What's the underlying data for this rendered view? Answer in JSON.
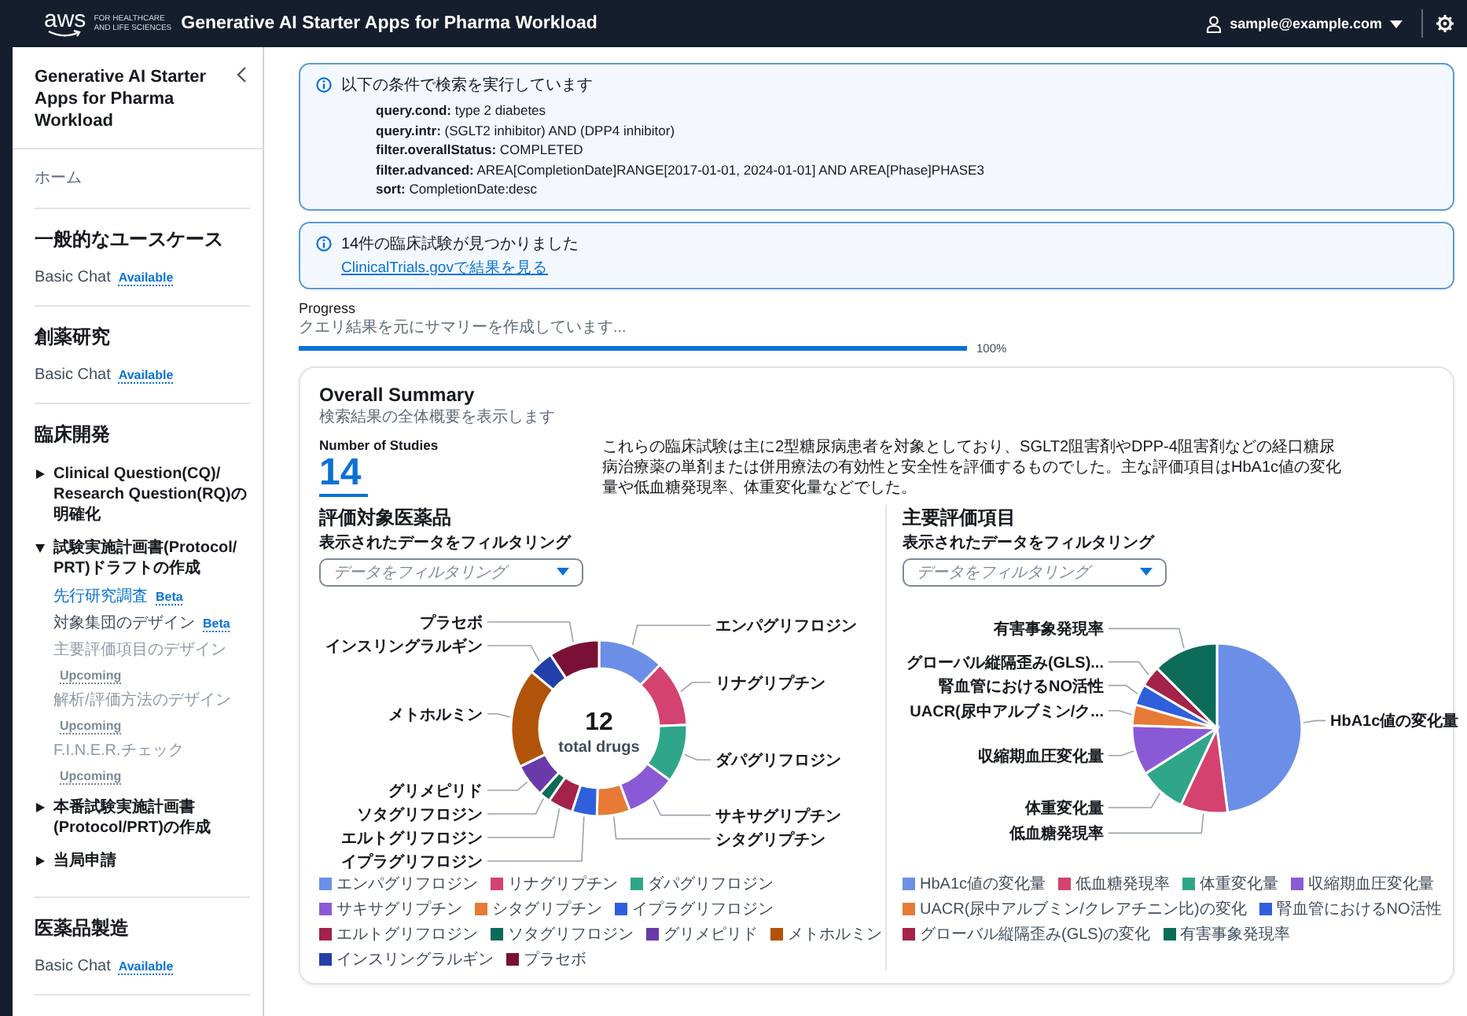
{
  "header": {
    "logo": {
      "wordmark": "aws",
      "tagline": [
        "FOR HEALTHCARE",
        "AND LIFE SCIENCES"
      ]
    },
    "title": "Generative AI Starter Apps for Pharma Workload",
    "user": "sample@example.com"
  },
  "sidebar": {
    "title": "Generative AI Starter Apps for Pharma Workload",
    "home": "ホーム",
    "sections": [
      {
        "title": "一般的なユースケース",
        "items": [
          {
            "kind": "link",
            "label": "Basic Chat",
            "badge": "Available",
            "selected": false,
            "disabled": false
          }
        ]
      },
      {
        "title": "創薬研究",
        "items": [
          {
            "kind": "link",
            "label": "Basic Chat",
            "badge": "Available",
            "selected": false,
            "disabled": false
          }
        ]
      },
      {
        "title": "臨床開発",
        "items": [
          {
            "kind": "group",
            "label": "Clinical Question(CQ)/ Research Question(RQ)の明確化",
            "expanded": false
          },
          {
            "kind": "group",
            "label": "試験実施計画書(Protocol/ PRT)ドラフトの作成",
            "expanded": true,
            "children": [
              {
                "label": "先行研究調査",
                "badge": "Beta",
                "selected": true,
                "disabled": false
              },
              {
                "label": "対象集団のデザイン",
                "badge": "Beta",
                "selected": false,
                "disabled": false
              },
              {
                "label": "主要評価項目のデザイン",
                "badge": "Upcoming",
                "selected": false,
                "disabled": true
              },
              {
                "label": "解析/評価方法のデザイン",
                "badge": "Upcoming",
                "selected": false,
                "disabled": true
              },
              {
                "label": "F.I.N.E.R.チェック",
                "badge": "Upcoming",
                "selected": false,
                "disabled": true
              }
            ]
          },
          {
            "kind": "group",
            "label": "本番試験実施計画書(Protocol/PRT)の作成",
            "expanded": false
          },
          {
            "kind": "group",
            "label": "当局申請",
            "expanded": false
          }
        ]
      },
      {
        "title": "医薬品製造",
        "items": [
          {
            "kind": "link",
            "label": "Basic Chat",
            "badge": "Available",
            "selected": false,
            "disabled": false
          }
        ]
      }
    ]
  },
  "search_info": {
    "title": "以下の条件で検索を実行しています",
    "params": [
      "**query.cond:** type 2 diabetes",
      "**query.intr:** (SGLT2 inhibitor) AND (DPP4 inhibitor)",
      "**filter.overallStatus:** COMPLETED",
      "**filter.advanced:** AREA[CompletionDate]RANGE[2017-01-01, 2024-01-01] AND AREA[Phase]PHASE3",
      "**sort:** CompletionDate:desc"
    ]
  },
  "result_info": {
    "message": "14件の臨床試験が見つかりました",
    "link": "ClinicalTrials.govで結果を見る"
  },
  "progress": {
    "label": "Progress",
    "description": "クエリ結果を元にサマリーを作成しています...",
    "level": 1,
    "reading": "100%"
  },
  "summary": {
    "title": "Overall Summary",
    "subtitle": "検索結果の全体概要を表示します",
    "stat_label": "Number of Studies",
    "stat_value": "14",
    "description": "これらの臨床試験は主に2型糖尿病患者を対象としており、SGLT2阻害剤やDPP-4阻害剤などの経口糖尿病治療薬の単剤または併用療法の有効性と安全性を評価するものでした。主な評価項目はHbA1c値の変化量や低血糖発現率、体重変化量などでした。",
    "panels": [
      {
        "title": "評価対象医薬品",
        "filter_label": "表示されたデータをフィルタリング",
        "filter": {
          "placeholder": "データをフィルタリング"
        },
        "center": {
          "value": "12",
          "label": "total drugs"
        },
        "chart_data": {
          "type": "donut",
          "categories": [
            "エンパグリフロジン",
            "リナグリプチン",
            "ダパグリフロジン",
            "サキサグリプチン",
            "シタグリプチン",
            "イプラグリフロジン",
            "エルトグリフロジン",
            "ソタグリフロジン",
            "グリメピリド",
            "メトホルミン",
            "インスリングラルギン",
            "プラセボ"
          ],
          "series": [
            {
              "values": [
                12.2,
                12.2,
                10.7,
                9.2,
                6.1,
                4.6,
                4.6,
                2.1,
                6.1,
                18.3,
                4.6,
                9.3
              ]
            }
          ]
        },
        "legend": [
          {
            "label": "エンパグリフロジン",
            "color": "#6b8fe6"
          },
          {
            "label": "リナグリプチン",
            "color": "#d4426f"
          },
          {
            "label": "ダパグリフロジン",
            "color": "#2fa58a"
          },
          {
            "label": "サキサグリプチン",
            "color": "#8a5ad6"
          },
          {
            "label": "シタグリプチン",
            "color": "#e67a36"
          },
          {
            "label": "イプラグリフロジン",
            "color": "#2f5fdb"
          },
          {
            "label": "エルトグリフロジン",
            "color": "#a3234a"
          },
          {
            "label": "ソタグリフロジン",
            "color": "#0d6b5a"
          },
          {
            "label": "グリメピリド",
            "color": "#6a3aa8"
          },
          {
            "label": "メトホルミン",
            "color": "#b2530a"
          },
          {
            "label": "インスリングラルギン",
            "color": "#2240a8"
          },
          {
            "label": "プラセボ",
            "color": "#7a1035"
          }
        ]
      },
      {
        "title": "主要評価項目",
        "filter_label": "表示されたデータをフィルタリング",
        "filter": {
          "placeholder": "データをフィルタリング"
        },
        "chart_data": {
          "type": "pie",
          "categories": [
            "HbA1c値の変化量",
            "低血糖発現率",
            "体重変化量",
            "収縮期血圧変化量",
            "UACR(尿中アルブミン/ク...",
            "腎血管におけるNO活性",
            "グローバル縦隔歪み(GLS)...",
            "有害事象発現率"
          ],
          "series": [
            {
              "values": [
                48,
                9,
                9,
                9.5,
                4,
                4,
                4,
                12.5
              ]
            }
          ]
        },
        "legend": [
          {
            "label": "HbA1c値の変化量",
            "color": "#6b8fe6"
          },
          {
            "label": "低血糖発現率",
            "color": "#d4426f"
          },
          {
            "label": "体重変化量",
            "color": "#2fa58a"
          },
          {
            "label": "収縮期血圧変化量",
            "color": "#8a5ad6"
          },
          {
            "label": "UACR(尿中アルブミン/クレアチニン比)の変化",
            "color": "#e67a36"
          },
          {
            "label": "腎血管におけるNO活性",
            "color": "#2f5fdb"
          },
          {
            "label": "グローバル縦隔歪み(GLS)の変化",
            "color": "#a3234a"
          },
          {
            "label": "有害事象発現率",
            "color": "#0d6b5a"
          }
        ]
      }
    ]
  }
}
